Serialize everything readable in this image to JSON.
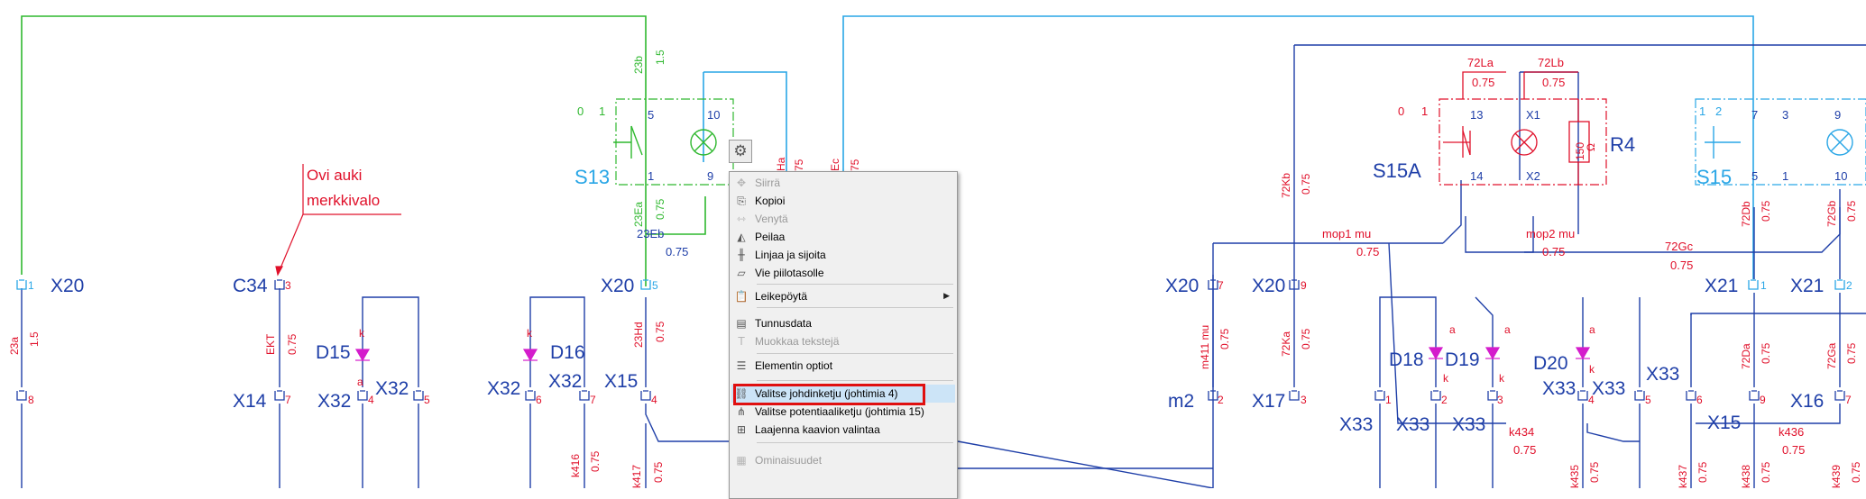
{
  "colors": {
    "wire_blue": "#1f3fa8",
    "wire_cyan": "#29a6e6",
    "wire_green": "#2fb82f",
    "label_red": "#e0102a",
    "component_magenta": "#d41ccc",
    "label_dark_blue": "#1f3fa8",
    "menu_highlight": "#cce4f7",
    "annotation_red": "#e01010"
  },
  "diagram": {
    "annotation": {
      "line1": "Ovi auki",
      "line2": "merkkivalo"
    },
    "components": {
      "s13": "S13",
      "s15a": "S15A",
      "s15": "S15",
      "r4": "R4",
      "r4_value": "150",
      "r4_unit": "Ω",
      "d15": "D15",
      "d16": "D16",
      "d18": "D18",
      "d19": "D19",
      "d20": "D20",
      "m2": "m2"
    },
    "connectors": {
      "x20_left": "X20",
      "x20_left_pin": "1",
      "c34": "C34",
      "c34_pin": "3",
      "x20_mid": "X20",
      "x20_mid_pin": "5",
      "x14_left_pin": "8",
      "x14": "X14",
      "x14_pin": "7",
      "x32_a": "X32",
      "x32_a_pin": "4",
      "x32_b": "X32",
      "x32_b_pin": "5",
      "x32_c": "X32",
      "x32_c_pin": "6",
      "x32_d": "X32",
      "x32_d_pin": "7",
      "x15": "X15",
      "x15_pin": "4",
      "x20_r1": "X20",
      "x20_r1_pin": "7",
      "x20_r2": "X20",
      "x20_r2_pin": "9",
      "x17": "X17",
      "x17_pin": "3",
      "m2_pin": "2",
      "x21_a": "X21",
      "x21_a_pin": "1",
      "x21_b": "X21",
      "x21_b_pin": "2",
      "x33_1": "X33",
      "x33_1_pin": "1",
      "x33_2": "X33",
      "x33_2_pin": "2",
      "x33_3": "X33",
      "x33_3_pin": "3",
      "x33_4": "X33",
      "x33_4_pin": "4",
      "x33_5": "X33",
      "x33_5_pin": "5",
      "x33_6": "X33",
      "x33_6_pin": "6",
      "x15_r": "X15",
      "x15_r_pin": "9",
      "x16": "X16",
      "x16_pin": "7"
    },
    "wire_labels": {
      "w23b": "23b",
      "w23b_size": "1.5",
      "w23a": "23a",
      "w23a_size": "1.5",
      "w23ea": "23Ea",
      "w23ea_size": "0.75",
      "w23eb": "23Eb",
      "w23eb_size": "0.75",
      "w23hd": "23Hd",
      "w23hd_size": "0.75",
      "wekt": "EKT",
      "wekt_size": "0.75",
      "wha": "Ha",
      "wha_size": "75",
      "wec": "Ec",
      "wec_size": "75",
      "w72la": "72La",
      "w72la_size": "0.75",
      "w72lb": "72Lb",
      "w72lb_size": "0.75",
      "w72kb": "72Kb",
      "w72kb_size": "0.75",
      "w72ka": "72Ka",
      "w72ka_size": "0.75",
      "w72db": "72Db",
      "w72db_size": "0.75",
      "w72gb": "72Gb",
      "w72gb_size": "0.75",
      "w72gc": "72Gc",
      "w72gc_size": "0.75",
      "w72da": "72Da",
      "w72da_size": "0.75",
      "w72ga": "72Ga",
      "w72ga_size": "0.75",
      "wmop1": "mop1 mu",
      "wmop1_size": "0.75",
      "wmop2": "mop2 mu",
      "wmop2_size": "0.75",
      "wm411": "m411 mu",
      "wm411_size": "0.75",
      "wk434": "k434",
      "wk434_size": "0.75",
      "wk436": "k436",
      "wk436_size": "0.75",
      "wk416": "k416",
      "wk416_size": "0.75",
      "wk417": "k417",
      "wk417_size": "0.75",
      "wk435": "k435",
      "wk435_size": "0.75",
      "wk437": "k437",
      "wk437_size": "0.75",
      "wk438": "k438",
      "wk438_size": "0.75",
      "wk439": "k439",
      "wk439_size": "0.75"
    },
    "terminals": {
      "s13_0": "0",
      "s13_1": "1",
      "s13_5": "5",
      "s13_10": "10",
      "s13_1b": "1",
      "s13_9": "9",
      "s15a_0": "0",
      "s15a_1": "1",
      "s15a_13": "13",
      "s15a_14": "14",
      "s15a_x1": "X1",
      "s15a_x2": "X2",
      "s15_1": "1",
      "s15_2": "2",
      "s15_7": "7",
      "s15_3": "3",
      "s15_9": "9",
      "s15_5": "5",
      "s15_1b": "1",
      "s15_10": "10",
      "k": "k",
      "a": "a"
    }
  },
  "context_menu": {
    "items": [
      {
        "label": "Siirrä",
        "icon": "move-icon",
        "glyph": "✥",
        "disabled": true
      },
      {
        "label": "Kopioi",
        "icon": "copy-icon",
        "glyph": "⎘",
        "disabled": false
      },
      {
        "label": "Venytä",
        "icon": "stretch-icon",
        "glyph": "⇿",
        "disabled": true
      },
      {
        "label": "Peilaa",
        "icon": "mirror-icon",
        "glyph": "◭",
        "disabled": false
      },
      {
        "label": "Linjaa ja sijoita",
        "icon": "align-icon",
        "glyph": "╫",
        "disabled": false
      },
      {
        "label": "Vie piilotasolle",
        "icon": "hide-layer-icon",
        "glyph": "▱",
        "disabled": false
      },
      {
        "label": "Leikepöytä",
        "icon": "clipboard-icon",
        "glyph": "📋",
        "disabled": false,
        "submenu_glyph": "▶"
      },
      {
        "label": "Tunnusdata",
        "icon": "id-data-icon",
        "glyph": "▤",
        "disabled": false
      },
      {
        "label": "Muokkaa tekstejä",
        "icon": "edit-text-icon",
        "glyph": "T",
        "disabled": true
      },
      {
        "label": "Elementin optiot",
        "icon": "element-options-icon",
        "glyph": "☰",
        "disabled": false
      },
      {
        "label": "Valitse johdinketju (johtimia 4)",
        "icon": "wire-chain-icon",
        "glyph": "⛓",
        "disabled": false,
        "highlighted": true
      },
      {
        "label": "Valitse potentiaaliketju (johtimia 15)",
        "icon": "potential-chain-icon",
        "glyph": "⋔",
        "disabled": false
      },
      {
        "label": "Laajenna kaavion valintaa",
        "icon": "expand-selection-icon",
        "glyph": "⊞",
        "disabled": false
      },
      {
        "label": "Ominaisuudet",
        "icon": "properties-icon",
        "glyph": "▦",
        "disabled": true
      }
    ]
  },
  "toolbar": {
    "gear_icon": "gear-icon",
    "gear_glyph": "⚙"
  }
}
